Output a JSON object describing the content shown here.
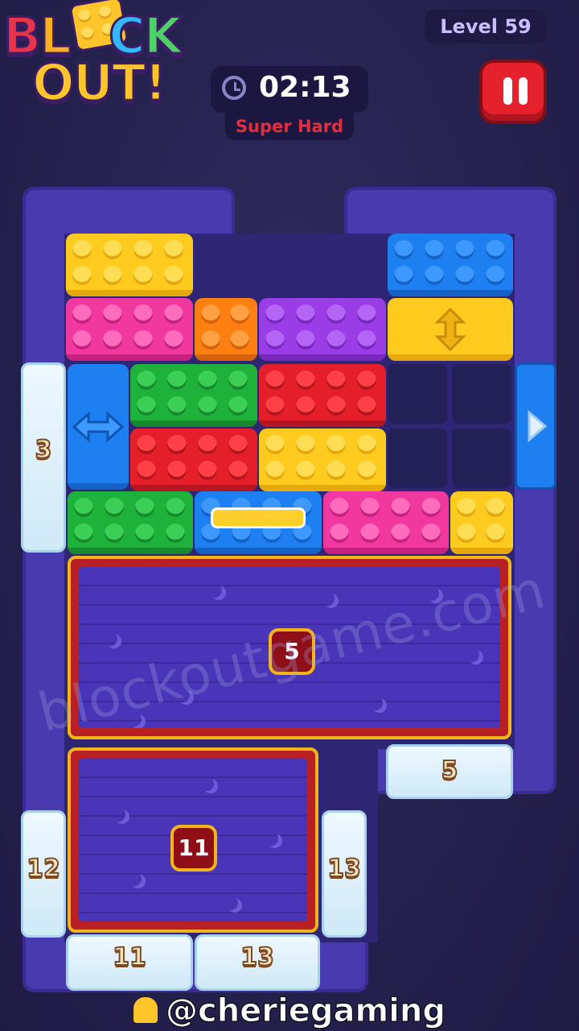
{
  "logo": {
    "line1": [
      "B",
      "L",
      "O",
      "C",
      "K"
    ],
    "line2": "OUT!"
  },
  "level": {
    "label": "Level 59"
  },
  "timer": {
    "time": "02:13",
    "difficulty": "Super Hard"
  },
  "board": {
    "gates": {
      "left_3": "3",
      "right_5": "5",
      "left_12": "12",
      "right_13": "13",
      "bottom_11": "11",
      "bottom_13": "13"
    },
    "crates": {
      "top": "5",
      "bottom": "11"
    }
  },
  "watermark": "blockoutgame.com",
  "footer": {
    "handle": "@cheriegaming"
  },
  "colors": {
    "background": "#26224f",
    "board": "#4a3ab0",
    "pause": "#e4212c",
    "difficulty": "#e0303f"
  }
}
